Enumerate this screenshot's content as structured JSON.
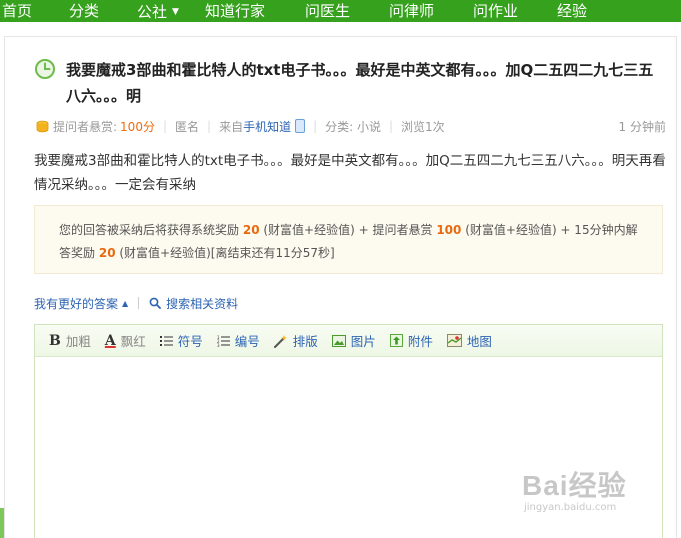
{
  "nav": {
    "items": [
      "首页",
      "分类",
      "公社",
      "知道行家",
      "问医生",
      "问律师",
      "问作业",
      "经验"
    ],
    "colors": {
      "bar": "#35a11c",
      "text": "#ffffff"
    }
  },
  "question": {
    "title": "我要魔戒3部曲和霍比特人的txt电子书。。。最好是中英文都有。。。加Q二五四二九七三五八六。。。明",
    "meta": {
      "reward_label": "提问者悬赏:",
      "reward_value": "100分",
      "anonymous": "匿名",
      "from_label": "来自",
      "from_link": "手机知道",
      "category": "分类: 小说",
      "views": "浏览1次",
      "time": "1 分钟前"
    },
    "body": "我要魔戒3部曲和霍比特人的txt电子书。。。最好是中英文都有。。。加Q二五四二九七三五八六。。。明天再看情况采纳。。。一定会有采纳"
  },
  "reward_box": {
    "part1": "您的回答被采纳后将获得系统奖励",
    "v1": "20",
    "part2": "(财富值+经验值) + 提问者悬赏",
    "v2": "100",
    "part3": "(财富值+经验值) + 15分钟内解答奖励",
    "v3": "20",
    "part4": "(财富值+经验值)[离结束还有11分57秒]"
  },
  "actions": {
    "better_answer": "我有更好的答案",
    "search": "搜索相关资料"
  },
  "editor": {
    "toolbar": {
      "bold": "加粗",
      "red": "飘红",
      "symbol": "符号",
      "numbering": "编号",
      "layout": "排版",
      "image": "图片",
      "attachment": "附件",
      "map": "地图"
    }
  },
  "watermark": {
    "main": "Bai经验",
    "sub": "jingyan.baidu.com"
  }
}
